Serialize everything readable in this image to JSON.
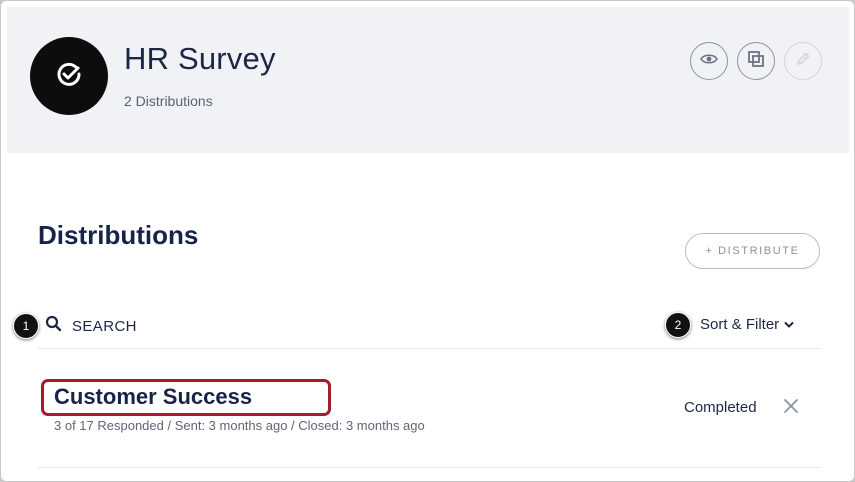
{
  "survey": {
    "title": "HR Survey",
    "subtitle": "2 Distributions",
    "avatar_icon": "check-circle-icon"
  },
  "header_actions": [
    {
      "name": "preview-button",
      "icon": "eye-icon",
      "enabled": true
    },
    {
      "name": "copy-button",
      "icon": "copy-icon",
      "enabled": true
    },
    {
      "name": "edit-button",
      "icon": "pencil-icon",
      "enabled": false
    }
  ],
  "section": {
    "title": "Distributions",
    "distribute_label": "+ DISTRIBUTE"
  },
  "toolbar": {
    "search_label": "SEARCH",
    "sort_filter_label": "Sort & Filter"
  },
  "callouts": {
    "search": "1",
    "sort": "2"
  },
  "distributions": [
    {
      "name": "Customer Success",
      "meta": "3 of 17 Responded  /  Sent: 3 months ago  /  Closed: 3 months ago",
      "status": "Completed"
    }
  ],
  "colors": {
    "header_bg": "#f1f2f6",
    "title_text": "#18234a",
    "highlight_border": "#a11d2b"
  }
}
